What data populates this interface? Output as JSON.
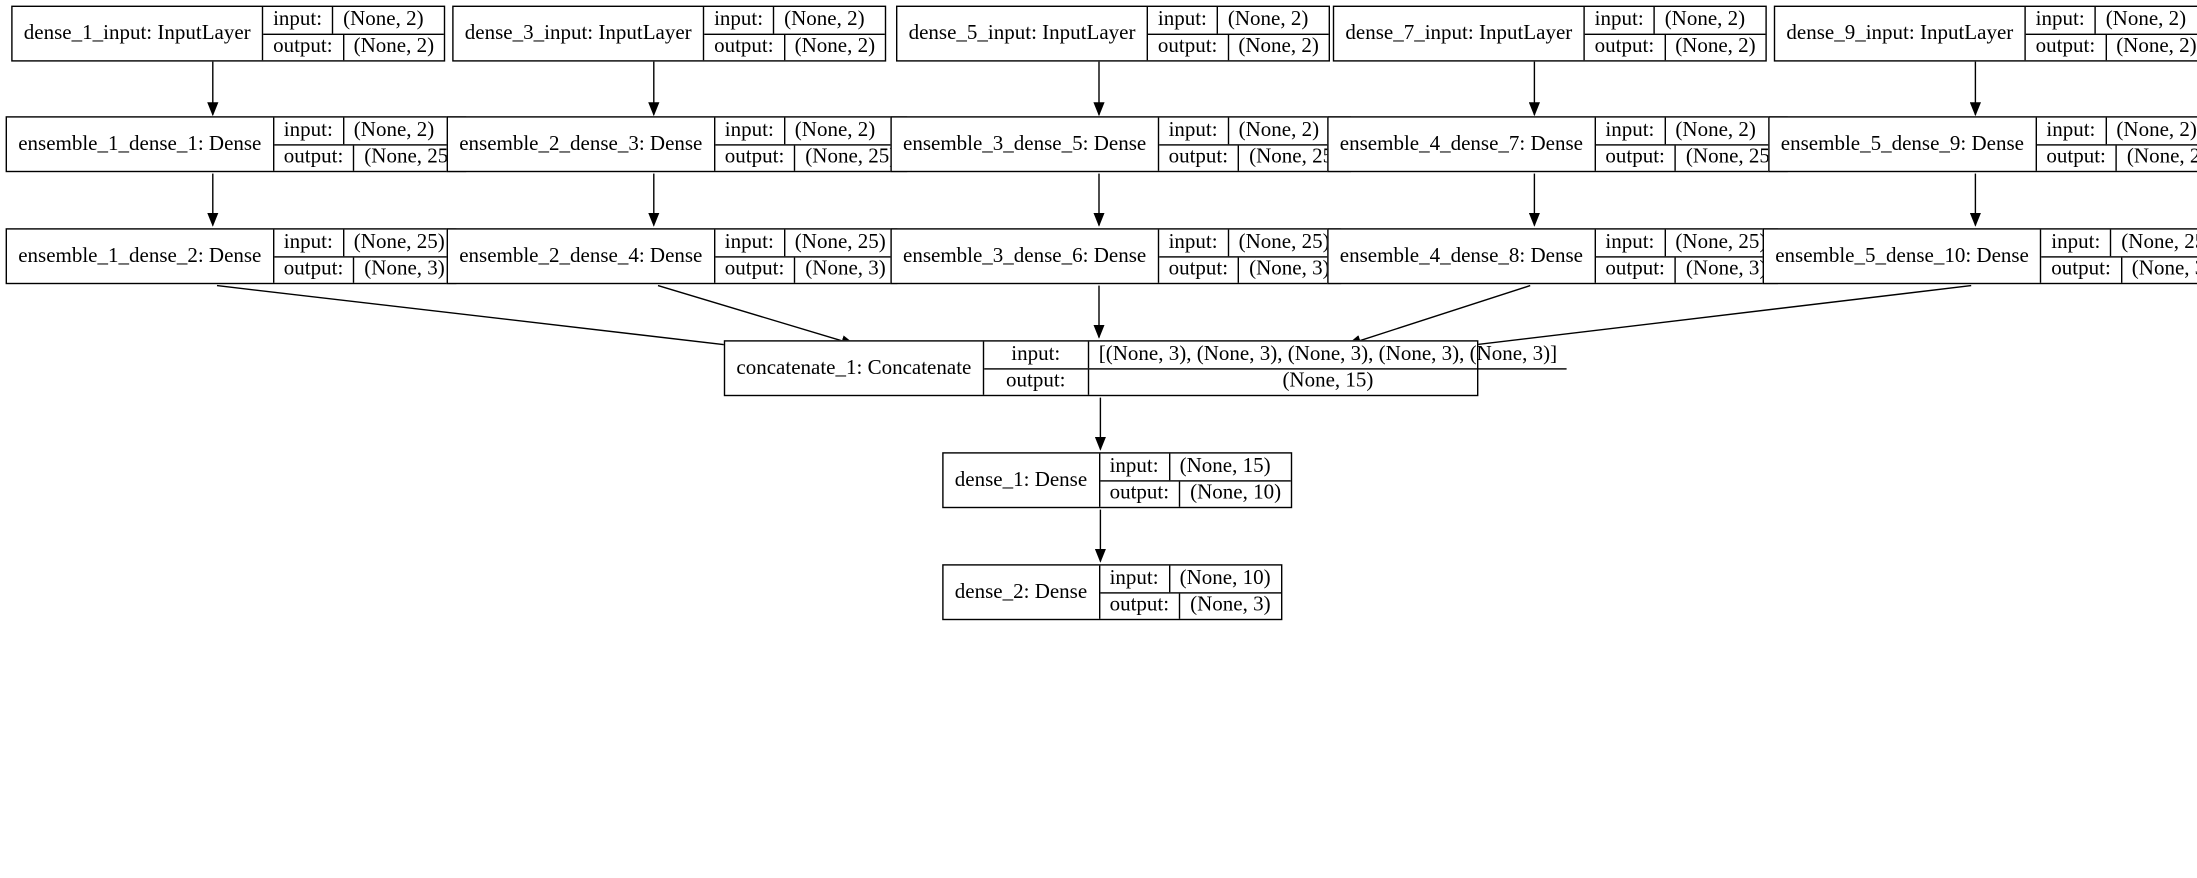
{
  "labels": {
    "input": "input:",
    "output": "output:"
  },
  "shapes": {
    "n2": "(None, 2)",
    "n25": "(None, 25)",
    "n3": "(None, 3)",
    "n15": "(None, 15)",
    "n10": "(None, 10)",
    "concat_in": "[(None, 3), (None, 3), (None, 3), (None, 3), (None, 3)]"
  },
  "nodes": {
    "in1": "dense_1_input: InputLayer",
    "in3": "dense_3_input: InputLayer",
    "in5": "dense_5_input: InputLayer",
    "in7": "dense_7_input: InputLayer",
    "in9": "dense_9_input: InputLayer",
    "e1d1": "ensemble_1_dense_1: Dense",
    "e2d3": "ensemble_2_dense_3: Dense",
    "e3d5": "ensemble_3_dense_5: Dense",
    "e4d7": "ensemble_4_dense_7: Dense",
    "e5d9": "ensemble_5_dense_9: Dense",
    "e1d2": "ensemble_1_dense_2: Dense",
    "e2d4": "ensemble_2_dense_4: Dense",
    "e3d6": "ensemble_3_dense_6: Dense",
    "e4d8": "ensemble_4_dense_8: Dense",
    "e5d10": "ensemble_5_dense_10: Dense",
    "concat": "concatenate_1: Concatenate",
    "d1": "dense_1: Dense",
    "d2": "dense_2: Dense"
  }
}
